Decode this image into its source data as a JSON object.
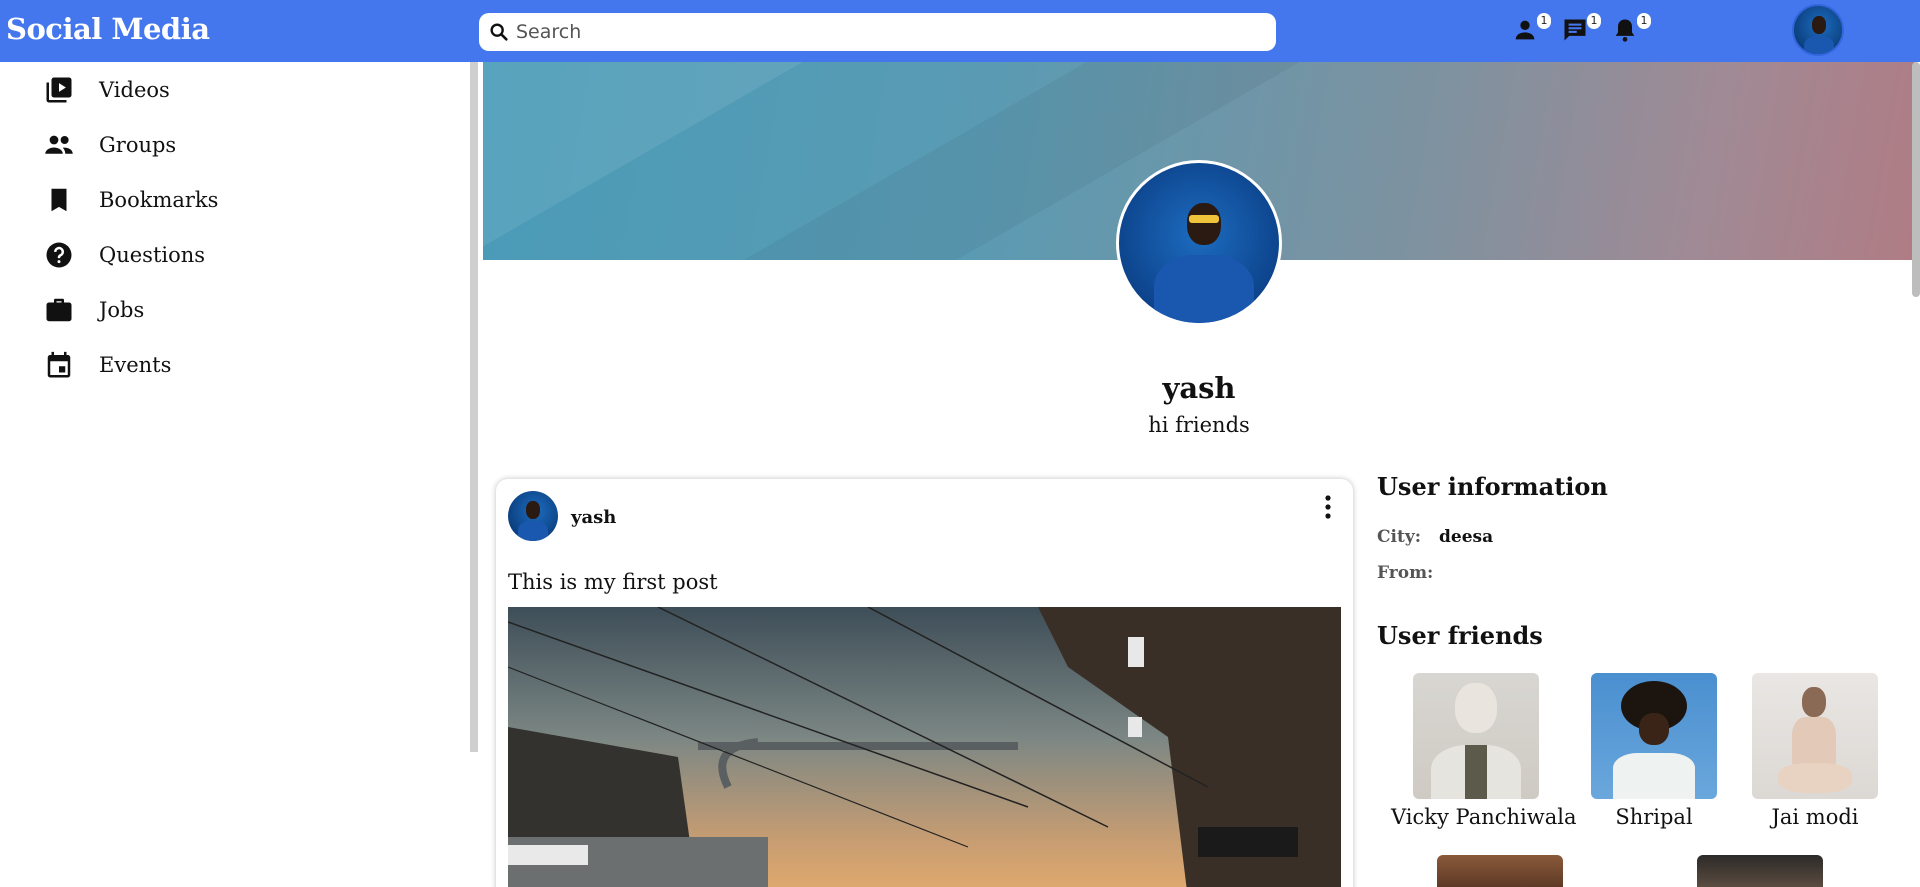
{
  "header": {
    "brand": "Social Media",
    "search_placeholder": "Search",
    "friend_requests_count": "1",
    "messages_count": "1",
    "notifications_count": "1",
    "accent_color": "#4477ee"
  },
  "sidebar": {
    "items": [
      {
        "label": "Videos",
        "icon": "video-library-icon"
      },
      {
        "label": "Groups",
        "icon": "groups-icon"
      },
      {
        "label": "Bookmarks",
        "icon": "bookmark-icon"
      },
      {
        "label": "Questions",
        "icon": "help-icon"
      },
      {
        "label": "Jobs",
        "icon": "briefcase-icon"
      },
      {
        "label": "Events",
        "icon": "calendar-icon"
      }
    ]
  },
  "profile": {
    "name": "yash",
    "bio": "hi friends"
  },
  "post": {
    "author": "yash",
    "text": "This is my first post"
  },
  "user_info": {
    "heading": "User information",
    "city_label": "City:",
    "city_value": "deesa",
    "from_label": "From:",
    "from_value": ""
  },
  "friends": {
    "heading": "User friends",
    "items": [
      {
        "name": "Vicky Panchiwala"
      },
      {
        "name": "Shripal"
      },
      {
        "name": "Jai modi"
      }
    ]
  }
}
